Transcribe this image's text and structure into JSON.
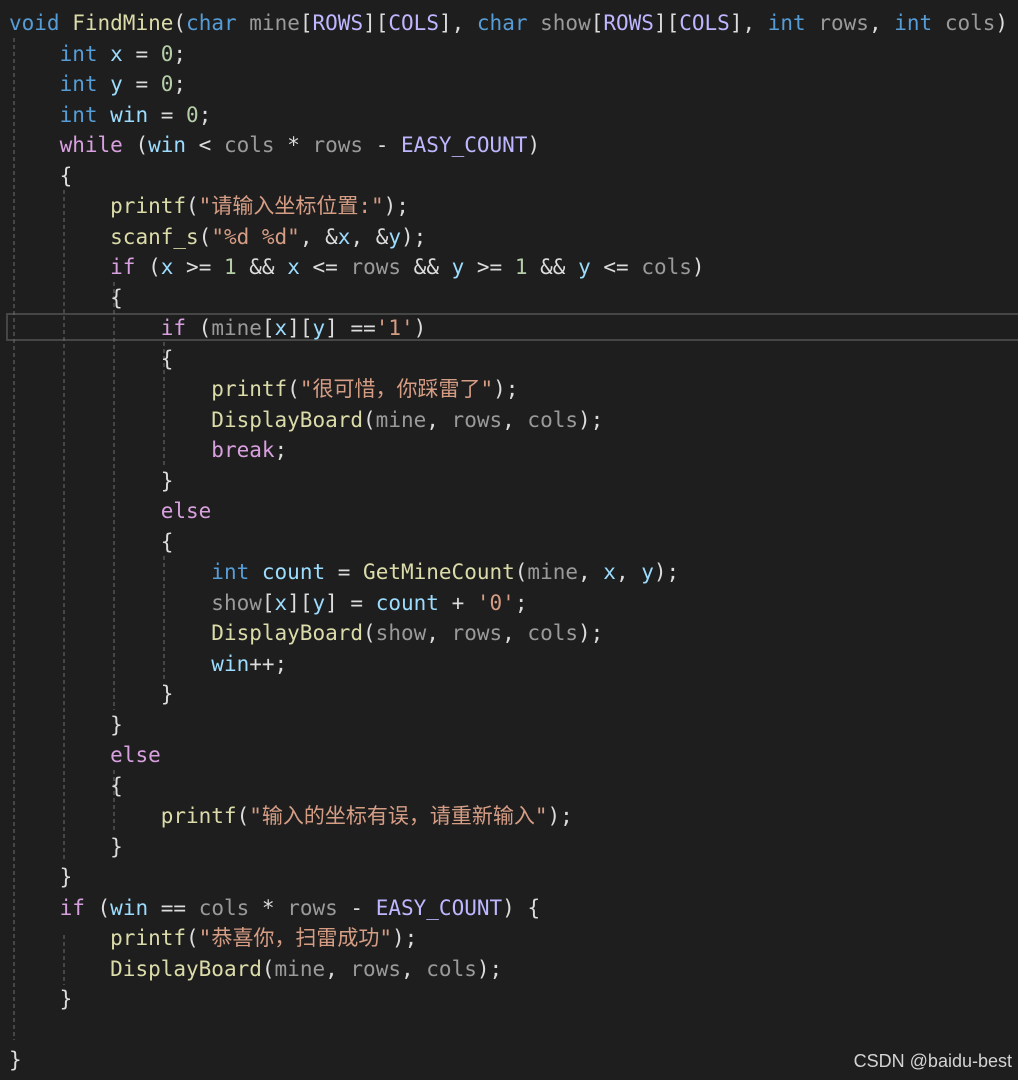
{
  "colors": {
    "background": "#1e1e1e",
    "keyword": "#569cd6",
    "control": "#d8a0df",
    "function": "#dcdcaa",
    "string": "#d69d85",
    "variable": "#9cdcfe",
    "macro": "#beb7ff",
    "param": "#9a9a9a",
    "number": "#b5cea8",
    "plain": "#dcdcdc",
    "guide": "#6e6e6e"
  },
  "watermark": "CSDN @baidu-best",
  "code_lines": [
    {
      "tokens": [
        [
          "void",
          "keyword"
        ],
        [
          " ",
          "plain"
        ],
        [
          "FindMine",
          "function"
        ],
        [
          "(",
          "plain"
        ],
        [
          "char",
          "keyword"
        ],
        [
          " ",
          "plain"
        ],
        [
          "mine",
          "param"
        ],
        [
          "[",
          "plain"
        ],
        [
          "ROWS",
          "macro"
        ],
        [
          "][",
          "plain"
        ],
        [
          "COLS",
          "macro"
        ],
        [
          "], ",
          "plain"
        ],
        [
          "char",
          "keyword"
        ],
        [
          " ",
          "plain"
        ],
        [
          "show",
          "param"
        ],
        [
          "[",
          "plain"
        ],
        [
          "ROWS",
          "macro"
        ],
        [
          "][",
          "plain"
        ],
        [
          "COLS",
          "macro"
        ],
        [
          "], ",
          "plain"
        ],
        [
          "int",
          "keyword"
        ],
        [
          " ",
          "plain"
        ],
        [
          "rows",
          "param"
        ],
        [
          ", ",
          "plain"
        ],
        [
          "int",
          "keyword"
        ],
        [
          " ",
          "plain"
        ],
        [
          "cols",
          "param"
        ],
        [
          ") {",
          "plain"
        ]
      ]
    },
    {
      "tokens": [
        [
          "    ",
          "plain"
        ],
        [
          "int",
          "keyword"
        ],
        [
          " ",
          "plain"
        ],
        [
          "x",
          "variable"
        ],
        [
          " = ",
          "plain"
        ],
        [
          "0",
          "number"
        ],
        [
          ";",
          "plain"
        ]
      ]
    },
    {
      "tokens": [
        [
          "    ",
          "plain"
        ],
        [
          "int",
          "keyword"
        ],
        [
          " ",
          "plain"
        ],
        [
          "y",
          "variable"
        ],
        [
          " = ",
          "plain"
        ],
        [
          "0",
          "number"
        ],
        [
          ";",
          "plain"
        ]
      ]
    },
    {
      "tokens": [
        [
          "    ",
          "plain"
        ],
        [
          "int",
          "keyword"
        ],
        [
          " ",
          "plain"
        ],
        [
          "win",
          "variable"
        ],
        [
          " = ",
          "plain"
        ],
        [
          "0",
          "number"
        ],
        [
          ";",
          "plain"
        ]
      ]
    },
    {
      "tokens": [
        [
          "    ",
          "plain"
        ],
        [
          "while",
          "control"
        ],
        [
          " (",
          "plain"
        ],
        [
          "win",
          "variable"
        ],
        [
          " < ",
          "plain"
        ],
        [
          "cols",
          "param"
        ],
        [
          " * ",
          "plain"
        ],
        [
          "rows",
          "param"
        ],
        [
          " - ",
          "plain"
        ],
        [
          "EASY_COUNT",
          "macro"
        ],
        [
          ")",
          "plain"
        ]
      ]
    },
    {
      "tokens": [
        [
          "    {",
          "plain"
        ]
      ]
    },
    {
      "tokens": [
        [
          "        ",
          "plain"
        ],
        [
          "printf",
          "function"
        ],
        [
          "(",
          "plain"
        ],
        [
          "\"请输入坐标位置:\"",
          "string"
        ],
        [
          ");",
          "plain"
        ]
      ]
    },
    {
      "tokens": [
        [
          "        ",
          "plain"
        ],
        [
          "scanf_s",
          "function"
        ],
        [
          "(",
          "plain"
        ],
        [
          "\"%d %d\"",
          "string"
        ],
        [
          ", &",
          "plain"
        ],
        [
          "x",
          "variable"
        ],
        [
          ", &",
          "plain"
        ],
        [
          "y",
          "variable"
        ],
        [
          ");",
          "plain"
        ]
      ]
    },
    {
      "tokens": [
        [
          "        ",
          "plain"
        ],
        [
          "if",
          "control"
        ],
        [
          " (",
          "plain"
        ],
        [
          "x",
          "variable"
        ],
        [
          " >= ",
          "plain"
        ],
        [
          "1",
          "number"
        ],
        [
          " && ",
          "plain"
        ],
        [
          "x",
          "variable"
        ],
        [
          " <= ",
          "plain"
        ],
        [
          "rows",
          "param"
        ],
        [
          " && ",
          "plain"
        ],
        [
          "y",
          "variable"
        ],
        [
          " >= ",
          "plain"
        ],
        [
          "1",
          "number"
        ],
        [
          " && ",
          "plain"
        ],
        [
          "y",
          "variable"
        ],
        [
          " <= ",
          "plain"
        ],
        [
          "cols",
          "param"
        ],
        [
          ")",
          "plain"
        ]
      ]
    },
    {
      "tokens": [
        [
          "        {",
          "plain"
        ]
      ]
    },
    {
      "tokens": [
        [
          "            ",
          "plain"
        ],
        [
          "if",
          "control"
        ],
        [
          " (",
          "plain"
        ],
        [
          "mine",
          "param"
        ],
        [
          "[",
          "plain"
        ],
        [
          "x",
          "variable"
        ],
        [
          "][",
          "plain"
        ],
        [
          "y",
          "variable"
        ],
        [
          "] ==",
          "plain"
        ],
        [
          "'1'",
          "string"
        ],
        [
          ")",
          "plain"
        ]
      ]
    },
    {
      "tokens": [
        [
          "            {",
          "plain"
        ]
      ]
    },
    {
      "tokens": [
        [
          "                ",
          "plain"
        ],
        [
          "printf",
          "function"
        ],
        [
          "(",
          "plain"
        ],
        [
          "\"很可惜，你踩雷了\"",
          "string"
        ],
        [
          ");",
          "plain"
        ]
      ]
    },
    {
      "tokens": [
        [
          "                ",
          "plain"
        ],
        [
          "DisplayBoard",
          "function"
        ],
        [
          "(",
          "plain"
        ],
        [
          "mine",
          "param"
        ],
        [
          ", ",
          "plain"
        ],
        [
          "rows",
          "param"
        ],
        [
          ", ",
          "plain"
        ],
        [
          "cols",
          "param"
        ],
        [
          ");",
          "plain"
        ]
      ]
    },
    {
      "tokens": [
        [
          "                ",
          "plain"
        ],
        [
          "break",
          "control"
        ],
        [
          ";",
          "plain"
        ]
      ]
    },
    {
      "tokens": [
        [
          "            }",
          "plain"
        ]
      ]
    },
    {
      "tokens": [
        [
          "            ",
          "plain"
        ],
        [
          "else",
          "control"
        ]
      ]
    },
    {
      "tokens": [
        [
          "            {",
          "plain"
        ]
      ]
    },
    {
      "tokens": [
        [
          "                ",
          "plain"
        ],
        [
          "int",
          "keyword"
        ],
        [
          " ",
          "plain"
        ],
        [
          "count",
          "variable"
        ],
        [
          " = ",
          "plain"
        ],
        [
          "GetMineCount",
          "function"
        ],
        [
          "(",
          "plain"
        ],
        [
          "mine",
          "param"
        ],
        [
          ", ",
          "plain"
        ],
        [
          "x",
          "variable"
        ],
        [
          ", ",
          "plain"
        ],
        [
          "y",
          "variable"
        ],
        [
          ");",
          "plain"
        ]
      ]
    },
    {
      "tokens": [
        [
          "                ",
          "plain"
        ],
        [
          "show",
          "param"
        ],
        [
          "[",
          "plain"
        ],
        [
          "x",
          "variable"
        ],
        [
          "][",
          "plain"
        ],
        [
          "y",
          "variable"
        ],
        [
          "] = ",
          "plain"
        ],
        [
          "count",
          "variable"
        ],
        [
          " + ",
          "plain"
        ],
        [
          "'0'",
          "string"
        ],
        [
          ";",
          "plain"
        ]
      ]
    },
    {
      "tokens": [
        [
          "                ",
          "plain"
        ],
        [
          "DisplayBoard",
          "function"
        ],
        [
          "(",
          "plain"
        ],
        [
          "show",
          "param"
        ],
        [
          ", ",
          "plain"
        ],
        [
          "rows",
          "param"
        ],
        [
          ", ",
          "plain"
        ],
        [
          "cols",
          "param"
        ],
        [
          ");",
          "plain"
        ]
      ]
    },
    {
      "tokens": [
        [
          "                ",
          "plain"
        ],
        [
          "win",
          "variable"
        ],
        [
          "++;",
          "plain"
        ]
      ]
    },
    {
      "tokens": [
        [
          "            }",
          "plain"
        ]
      ]
    },
    {
      "tokens": [
        [
          "        }",
          "plain"
        ]
      ]
    },
    {
      "tokens": [
        [
          "        ",
          "plain"
        ],
        [
          "else",
          "control"
        ]
      ]
    },
    {
      "tokens": [
        [
          "        {",
          "plain"
        ]
      ]
    },
    {
      "tokens": [
        [
          "            ",
          "plain"
        ],
        [
          "printf",
          "function"
        ],
        [
          "(",
          "plain"
        ],
        [
          "\"输入的坐标有误，请重新输入\"",
          "string"
        ],
        [
          ");",
          "plain"
        ]
      ]
    },
    {
      "tokens": [
        [
          "        }",
          "plain"
        ]
      ]
    },
    {
      "tokens": [
        [
          "    }",
          "plain"
        ]
      ]
    },
    {
      "tokens": [
        [
          "    ",
          "plain"
        ],
        [
          "if",
          "control"
        ],
        [
          " (",
          "plain"
        ],
        [
          "win",
          "variable"
        ],
        [
          " == ",
          "plain"
        ],
        [
          "cols",
          "param"
        ],
        [
          " * ",
          "plain"
        ],
        [
          "rows",
          "param"
        ],
        [
          " - ",
          "plain"
        ],
        [
          "EASY_COUNT",
          "macro"
        ],
        [
          ") {",
          "plain"
        ]
      ]
    },
    {
      "tokens": [
        [
          "        ",
          "plain"
        ],
        [
          "printf",
          "function"
        ],
        [
          "(",
          "plain"
        ],
        [
          "\"恭喜你，扫雷成功\"",
          "string"
        ],
        [
          ");",
          "plain"
        ]
      ]
    },
    {
      "tokens": [
        [
          "        ",
          "plain"
        ],
        [
          "DisplayBoard",
          "function"
        ],
        [
          "(",
          "plain"
        ],
        [
          "mine",
          "param"
        ],
        [
          ", ",
          "plain"
        ],
        [
          "rows",
          "param"
        ],
        [
          ", ",
          "plain"
        ],
        [
          "cols",
          "param"
        ],
        [
          ");",
          "plain"
        ]
      ]
    },
    {
      "tokens": [
        [
          "    }",
          "plain"
        ]
      ]
    },
    {
      "tokens": [
        [
          "",
          "plain"
        ]
      ]
    },
    {
      "tokens": [
        [
          "}",
          "plain"
        ]
      ]
    }
  ]
}
